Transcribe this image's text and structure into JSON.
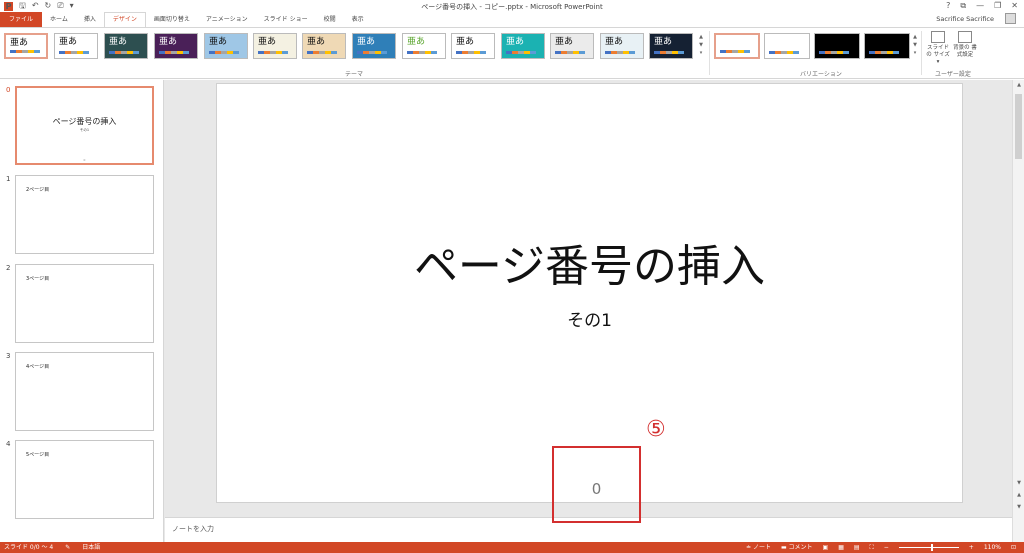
{
  "window": {
    "title": "ページ番号の挿入 - コピー.pptx - Microsoft PowerPoint",
    "app_icon": "P",
    "user": "Sacrifice Sacrifice",
    "controls": {
      "help": "?",
      "ribbon_opts": "⧉",
      "minimize": "—",
      "restore": "❐",
      "close": "✕"
    }
  },
  "qat": {
    "save": "🖫",
    "undo": "↶",
    "redo": "↻",
    "present": "⎚",
    "more": "▾"
  },
  "tabs": [
    {
      "label": "ファイル"
    },
    {
      "label": "ホーム"
    },
    {
      "label": "挿入"
    },
    {
      "label": "デザイン"
    },
    {
      "label": "画面切り替え"
    },
    {
      "label": "アニメーション"
    },
    {
      "label": "スライド ショー"
    },
    {
      "label": "校閲"
    },
    {
      "label": "表示"
    }
  ],
  "ribbon": {
    "themes": [
      {
        "text": "亜あ",
        "bg": "#ffffff",
        "fg": "#111111"
      },
      {
        "text": "亜あ",
        "bg": "#ffffff",
        "fg": "#111111"
      },
      {
        "text": "亜あ",
        "bg": "#2d4f50",
        "fg": "#ffffff"
      },
      {
        "text": "亜あ",
        "bg": "#4a2058",
        "fg": "#ffffff"
      },
      {
        "text": "亜あ",
        "bg": "#9fc7e6",
        "fg": "#111111"
      },
      {
        "text": "亜あ",
        "bg": "#f4f1e2",
        "fg": "#111111"
      },
      {
        "text": "亜あ",
        "bg": "#efd9b5",
        "fg": "#111111"
      },
      {
        "text": "亜あ",
        "bg": "#2f7fb8",
        "fg": "#ffffff"
      },
      {
        "text": "亜あ",
        "bg": "#ffffff",
        "fg": "#5aa52e"
      },
      {
        "text": "亜あ",
        "bg": "#ffffff",
        "fg": "#111111"
      },
      {
        "text": "亜あ",
        "bg": "#1bb2b2",
        "fg": "#ffffff"
      },
      {
        "text": "亜あ",
        "bg": "#ebebeb",
        "fg": "#111111"
      },
      {
        "text": "亜あ",
        "bg": "#e8f1f5",
        "fg": "#111111"
      },
      {
        "text": "亜あ",
        "bg": "#152133",
        "fg": "#ffffff"
      }
    ],
    "variations": [
      {
        "bg": "#ffffff"
      },
      {
        "bg": "#ffffff"
      },
      {
        "bg": "#000000"
      },
      {
        "bg": "#000000"
      }
    ],
    "theme_group_label": "テーマ",
    "variation_group_label": "バリエーション",
    "custom_group_label": "ユーザー設定",
    "slide_size_label": "スライドの サイズ ▾",
    "bg_format_label": "背景の 書式設定",
    "scroll_up": "▲",
    "scroll_down": "▼",
    "scroll_more": "▾"
  },
  "slides": [
    {
      "num": "0",
      "title": "ページ番号の挿入",
      "subtitle": "その1",
      "footer": "0"
    },
    {
      "num": "1",
      "title": "2ページ目"
    },
    {
      "num": "2",
      "title": "3ページ目"
    },
    {
      "num": "3",
      "title": "4ページ目"
    },
    {
      "num": "4",
      "title": "5ページ目"
    }
  ],
  "current_slide": {
    "title": "ページ番号の挿入",
    "subtitle": "その1",
    "page_number": "0",
    "annotation_marker": "⑤"
  },
  "notes": {
    "placeholder": "ノートを入力"
  },
  "status": {
    "slide_info": "スライド 0/0 ～ 4",
    "language": "日本語",
    "notes_btn": "≐ ノート",
    "comments_btn": "▬ コメント",
    "zoom_minus": "−",
    "zoom_plus": "+",
    "zoom": "110%"
  },
  "colors": {
    "accent": "#d24726",
    "highlight_box": "#d32f2f"
  }
}
